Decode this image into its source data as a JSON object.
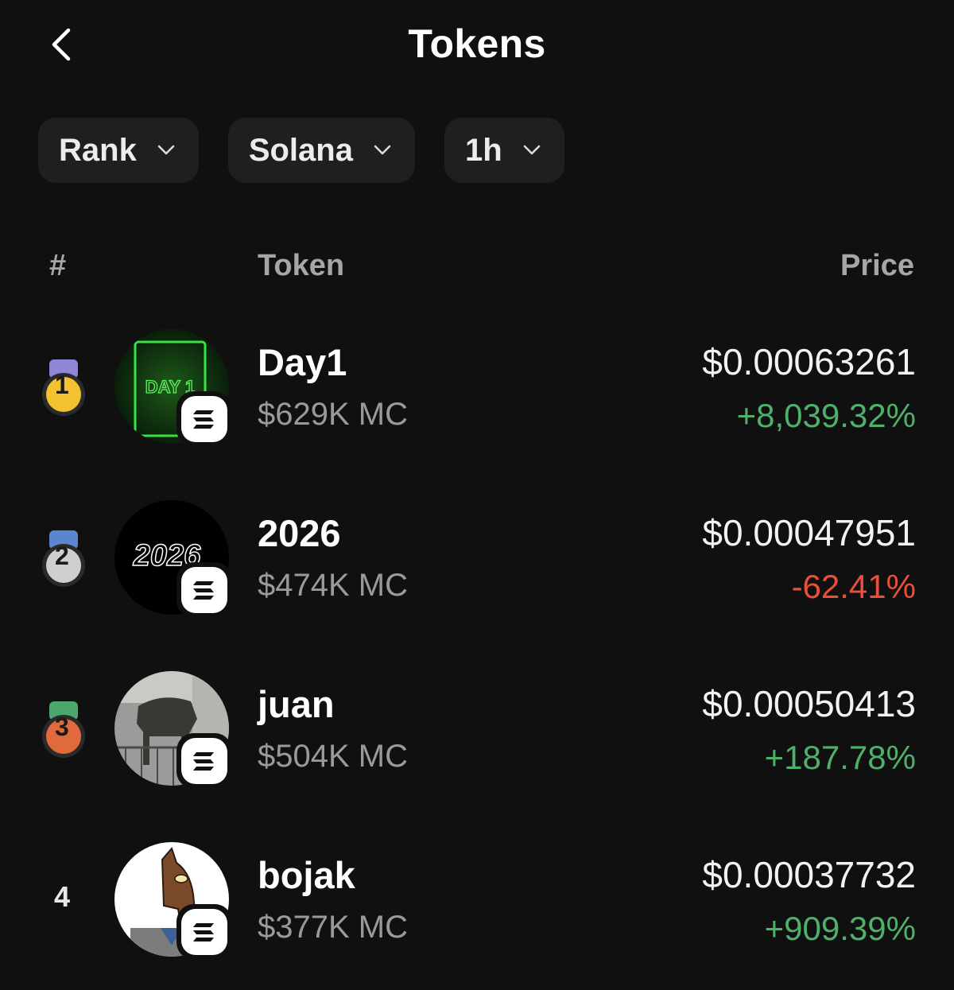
{
  "header": {
    "title": "Tokens",
    "back_icon": "chevron-left-icon"
  },
  "filters": [
    {
      "label": "Rank",
      "icon": "chevron-down-icon"
    },
    {
      "label": "Solana",
      "icon": "chevron-down-icon"
    },
    {
      "label": "1h",
      "icon": "chevron-down-icon"
    }
  ],
  "columns": {
    "rank": "#",
    "token": "Token",
    "price": "Price"
  },
  "colors": {
    "positive": "#4fb06b",
    "negative": "#e8503a",
    "gold": "#f2c230",
    "silver": "#cfcfcf",
    "bronze": "#e06a3c"
  },
  "tokens": [
    {
      "rank": "1",
      "medal": "gold-medal-icon",
      "name": "Day1",
      "market_cap": "$629K MC",
      "price": "$0.00063261",
      "change": "+8,039.32%",
      "avatar_text": "DAY 1",
      "chain": "solana-icon"
    },
    {
      "rank": "2",
      "medal": "silver-medal-icon",
      "name": "2026",
      "market_cap": "$474K MC",
      "price": "$0.00047951",
      "change": "-62.41%",
      "avatar_text": "2026",
      "chain": "solana-icon"
    },
    {
      "rank": "3",
      "medal": "bronze-medal-icon",
      "name": "juan",
      "market_cap": "$504K MC",
      "price": "$0.00050413",
      "change": "+187.78%",
      "chain": "solana-icon"
    },
    {
      "rank": "4",
      "name": "bojak",
      "market_cap": "$377K MC",
      "price": "$0.00037732",
      "change": "+909.39%",
      "chain": "solana-icon"
    }
  ]
}
